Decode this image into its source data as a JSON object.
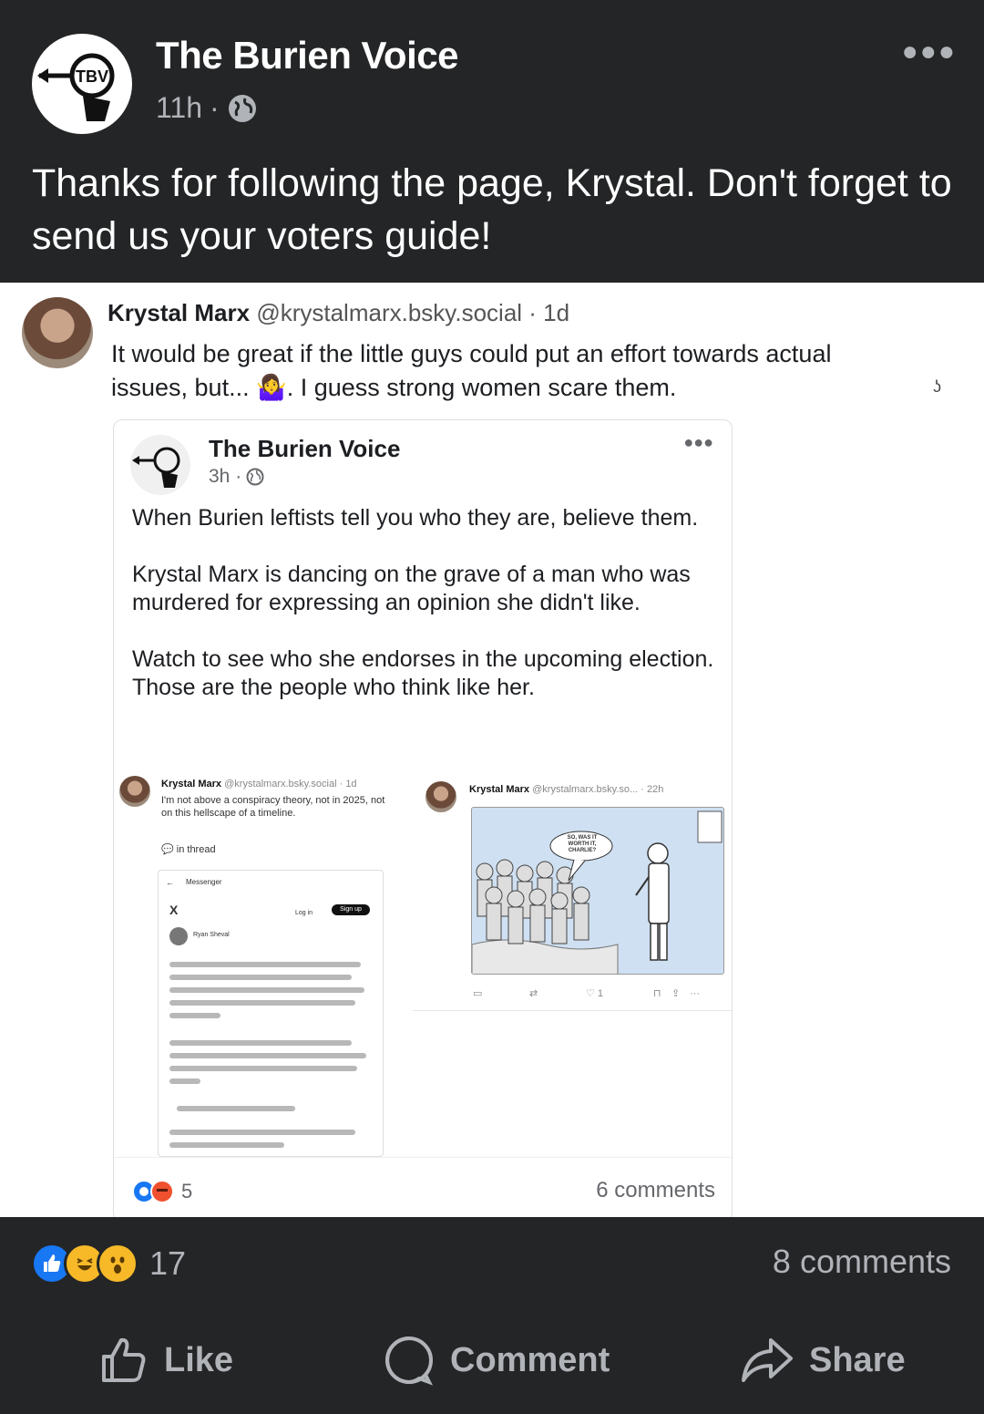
{
  "post": {
    "page_name": "The Burien Voice",
    "time": "11h",
    "separator": "·",
    "text": "Thanks for following the page, Krystal. Don't forget to send us your voters guide!"
  },
  "screenshot": {
    "reply": {
      "author": "Krystal Marx",
      "handle": "@krystalmarx.bsky.social · 1d",
      "text": "It would be great if the little guys could put an effort towards actual issues, but... 🤷‍♀️. I guess strong women scare them."
    },
    "side_mark": "ʖ",
    "inner_post": {
      "page_name": "The Burien Voice",
      "time": "3h ·",
      "paragraphs": [
        "When Burien leftists tell you who they are, believe them.",
        "Krystal Marx is dancing on the grave of a man who was murdered for expressing an opinion she didn't like.",
        "Watch to see who she endorses in the upcoming election. Those are the people who think like her."
      ],
      "embed_left": {
        "author": "Krystal Marx",
        "handle": "@krystalmarx.bsky.social · 1d",
        "text": "I'm not above a conspiracy theory, not in 2025, not on this hellscape of a timeline.",
        "thread_label": "in thread",
        "app_label": "Messenger",
        "x_label": "X",
        "login": "Log in",
        "signup": "Sign up",
        "tweet_author": "Ryan Sheval"
      },
      "embed_right": {
        "author": "Krystal Marx",
        "handle": "@krystalmarx.bsky.so... · 22h",
        "bubble": "SO, WAS IT WORTH IT, CHARLIE?",
        "likes": "1"
      },
      "reaction_count": "5",
      "comments": "6 comments"
    }
  },
  "footer": {
    "reaction_count": "17",
    "comments": "8 comments",
    "like": "Like",
    "comment": "Comment",
    "share": "Share"
  }
}
